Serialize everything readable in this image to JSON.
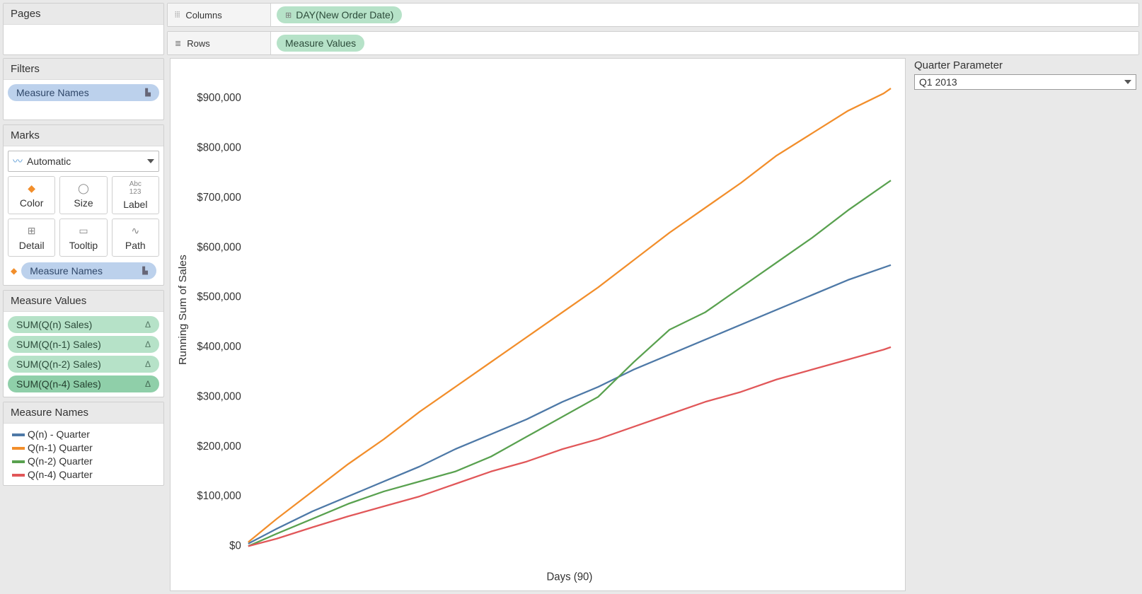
{
  "shelves": {
    "columns_label": "Columns",
    "rows_label": "Rows",
    "columns_pill": "DAY(New Order Date)",
    "rows_pill": "Measure Values"
  },
  "cards": {
    "pages_title": "Pages",
    "filters_title": "Filters",
    "marks_title": "Marks",
    "measure_values_title": "Measure Values",
    "measure_names_title": "Measure Names"
  },
  "filters": {
    "pill": "Measure Names"
  },
  "marks": {
    "type": "Automatic",
    "buttons": {
      "color": "Color",
      "size": "Size",
      "label": "Label",
      "detail": "Detail",
      "tooltip": "Tooltip",
      "path": "Path"
    },
    "color_pill": "Measure Names"
  },
  "measure_values": {
    "items": [
      {
        "label": "SUM(Q(n) Sales)",
        "dark": false
      },
      {
        "label": "SUM(Q(n-1) Sales)",
        "dark": false
      },
      {
        "label": "SUM(Q(n-2) Sales)",
        "dark": false
      },
      {
        "label": "SUM(Q(n-4) Sales)",
        "dark": true
      }
    ]
  },
  "legend": {
    "items": [
      {
        "label": "Q(n) - Quarter",
        "color": "#4e79a7"
      },
      {
        "label": "Q(n-1) Quarter",
        "color": "#f28e2b"
      },
      {
        "label": "Q(n-2) Quarter",
        "color": "#59a14f"
      },
      {
        "label": "Q(n-4) Quarter",
        "color": "#e15759"
      }
    ]
  },
  "parameter": {
    "title": "Quarter Parameter",
    "value": "Q1 2013"
  },
  "chart_data": {
    "type": "line",
    "xlabel": "Days (90)",
    "ylabel": "Running Sum of Sales",
    "xlim": [
      1,
      91
    ],
    "ylim": [
      0,
      950000
    ],
    "y_ticks": [
      0,
      100000,
      200000,
      300000,
      400000,
      500000,
      600000,
      700000,
      800000,
      900000
    ],
    "y_tick_labels": [
      "$0",
      "$100,000",
      "$200,000",
      "$300,000",
      "$400,000",
      "$500,000",
      "$600,000",
      "$700,000",
      "$800,000",
      "$900,000"
    ],
    "x": [
      1,
      5,
      10,
      15,
      20,
      25,
      30,
      35,
      40,
      45,
      50,
      55,
      60,
      65,
      70,
      75,
      80,
      85,
      90,
      91
    ],
    "series": [
      {
        "name": "Q(n) - Quarter",
        "color": "#4e79a7",
        "values": [
          5000,
          35000,
          70000,
          100000,
          130000,
          160000,
          195000,
          225000,
          255000,
          290000,
          320000,
          355000,
          385000,
          415000,
          445000,
          475000,
          505000,
          535000,
          560000,
          565000
        ]
      },
      {
        "name": "Q(n-1) Quarter",
        "color": "#f28e2b",
        "values": [
          8000,
          55000,
          110000,
          165000,
          215000,
          270000,
          320000,
          370000,
          420000,
          470000,
          520000,
          575000,
          630000,
          680000,
          730000,
          785000,
          830000,
          875000,
          910000,
          920000
        ]
      },
      {
        "name": "Q(n-2) Quarter",
        "color": "#59a14f",
        "values": [
          0,
          25000,
          55000,
          85000,
          110000,
          130000,
          150000,
          180000,
          220000,
          260000,
          300000,
          370000,
          435000,
          470000,
          520000,
          570000,
          620000,
          675000,
          725000,
          735000
        ]
      },
      {
        "name": "Q(n-4) Quarter",
        "color": "#e15759",
        "values": [
          0,
          15000,
          38000,
          60000,
          80000,
          100000,
          125000,
          150000,
          170000,
          195000,
          215000,
          240000,
          265000,
          290000,
          310000,
          335000,
          355000,
          375000,
          395000,
          400000
        ]
      }
    ]
  },
  "icons": {
    "plus": "⊞"
  }
}
